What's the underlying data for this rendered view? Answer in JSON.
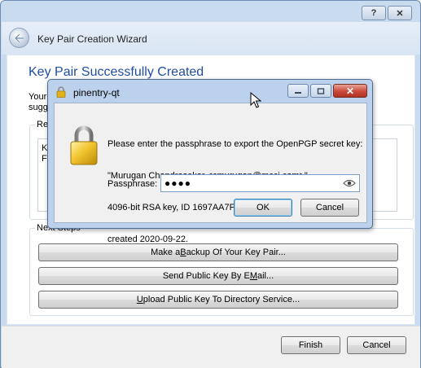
{
  "wizard": {
    "window_title": "Key Pair Creation Wizard",
    "help_glyph": "?",
    "close_glyph": "✕",
    "heading": "Key Pair Successfully Created",
    "intro_fragment_line1": "Your",
    "intro_fragment_line2": "sugg",
    "result_group_label": "Re",
    "result_text_line1": "Ke",
    "result_text_line2": "Fi",
    "next_steps_label": "Next Steps",
    "buttons": {
      "backup": {
        "pre": "Make a ",
        "hot": "B",
        "post": "ackup Of Your Key Pair..."
      },
      "email": {
        "pre": "Send Public Key By E",
        "hot": "M",
        "post": "ail..."
      },
      "upload": {
        "pre": "",
        "hot": "U",
        "post": "pload Public Key To Directory Service..."
      },
      "finish": "Finish",
      "cancel": "Cancel"
    }
  },
  "pinentry": {
    "title": "pinentry-qt",
    "description_lines": [
      "Please enter the passphrase to export the OpenPGP secret key:",
      "\"Murugan Chandrasekar <cmurugan@mcci.com>\"",
      "4096-bit RSA key, ID 1697AA7F4812D7EF,",
      "created 2020-09-22."
    ],
    "passphrase_label": "Passphrase:",
    "passphrase_masked": "●●●●",
    "ok_label": "OK",
    "cancel_label": "Cancel",
    "close_glyph": "✕"
  },
  "colors": {
    "heading_blue": "#1f4d9e",
    "titlebar": "#c8dbef",
    "close_red": "#c9493a",
    "lock_gold": "#e2b21c"
  }
}
